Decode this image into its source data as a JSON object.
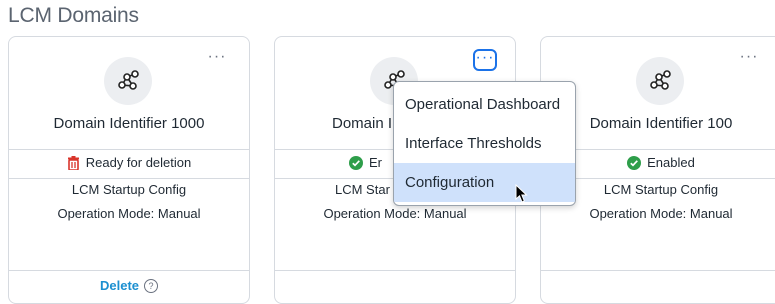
{
  "page": {
    "title": "LCM Domains"
  },
  "cards": [
    {
      "name": "Domain Identifier 1000",
      "status": "Ready for deletion",
      "status_icon": "trash-icon",
      "config": "LCM Startup Config",
      "mode": "Operation Mode: Manual",
      "action": "Delete",
      "kebab": "···"
    },
    {
      "name": "Domain I",
      "status": "Er",
      "status_icon": "check-circle-icon",
      "config": "LCM Star",
      "mode": "Operation Mode: Manual",
      "kebab": "···"
    },
    {
      "name": "Domain Identifier 100",
      "status": "Enabled",
      "status_icon": "check-circle-icon",
      "config": "LCM Startup Config",
      "mode": "Operation Mode: Manual",
      "kebab": "···"
    }
  ],
  "menu": {
    "items": [
      "Operational Dashboard",
      "Interface Thresholds",
      "Configuration"
    ],
    "hovered": "Configuration"
  },
  "colors": {
    "accent": "#1b72e8",
    "link": "#1b8fd0",
    "enabled": "#2e9e4a",
    "danger": "#d9342b"
  }
}
